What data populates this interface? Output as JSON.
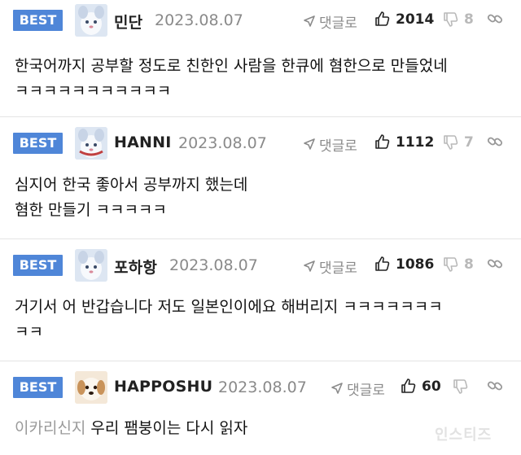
{
  "comments": [
    {
      "badge": "BEST",
      "nickname": "민단",
      "date": "2023.08.07",
      "reply_label": "댓글로",
      "likes": "2014",
      "dislikes": "8",
      "text": "한국어까지 공부할 정도로 친한인 사람을 한큐에 혐한으로 만들었네\nㅋㅋㅋㅋㅋㅋㅋㅋㅋㅋㅋ"
    },
    {
      "badge": "BEST",
      "nickname": "HANNI",
      "date": "2023.08.07",
      "reply_label": "댓글로",
      "likes": "1112",
      "dislikes": "7",
      "text": "심지어 한국 좋아서 공부까지 했는데\n혐한 만들기 ㅋㅋㅋㅋㅋ"
    },
    {
      "badge": "BEST",
      "nickname": "포하항",
      "date": "2023.08.07",
      "reply_label": "댓글로",
      "likes": "1086",
      "dislikes": "8",
      "text": "거기서 어 반갑습니다 저도 일본인이에요 해버리지 ㅋㅋㅋㅋㅋㅋㅋ\nㅋㅋ"
    },
    {
      "badge": "BEST",
      "nickname": "HAPPOSHU",
      "date": "2023.08.07",
      "reply_label": "댓글로",
      "likes": "60",
      "dislikes": "",
      "reply_to": "이카리신지",
      "text": "우리 팸붕이는 다시 읽자"
    }
  ],
  "watermark": "인스티즈",
  "colors": {
    "badge": "#4f86d8",
    "muted": "#8a8a8a",
    "divider": "#e4e4e4"
  },
  "icons": [
    "share-arrow-icon",
    "thumbs-up-icon",
    "thumbs-down-icon",
    "link-icon",
    "avatar-image"
  ]
}
